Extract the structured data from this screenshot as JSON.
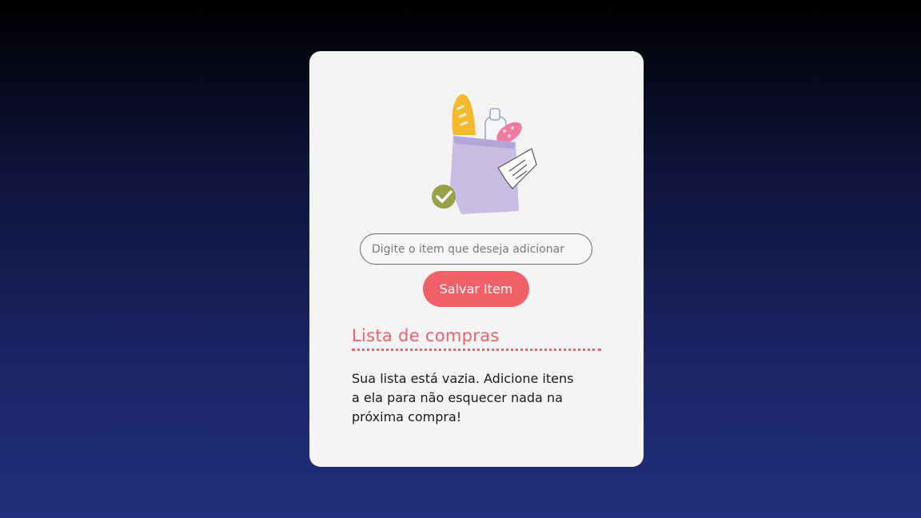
{
  "colors": {
    "accent": "#f2616a",
    "card_background": "#f4f4f4",
    "bag": "#c9bde3",
    "check_badge": "#9aa04a"
  },
  "illustration": {
    "icon": "grocery-bag-icon",
    "badge_icon": "checkmark-icon"
  },
  "form": {
    "input_placeholder": "Digite o item que deseja adicionar",
    "input_value": "",
    "save_label": "Salvar Item"
  },
  "list": {
    "title": "Lista de compras",
    "empty_message": "Sua lista está vazia. Adicione itens a ela para não esquecer nada na próxima compra!"
  }
}
